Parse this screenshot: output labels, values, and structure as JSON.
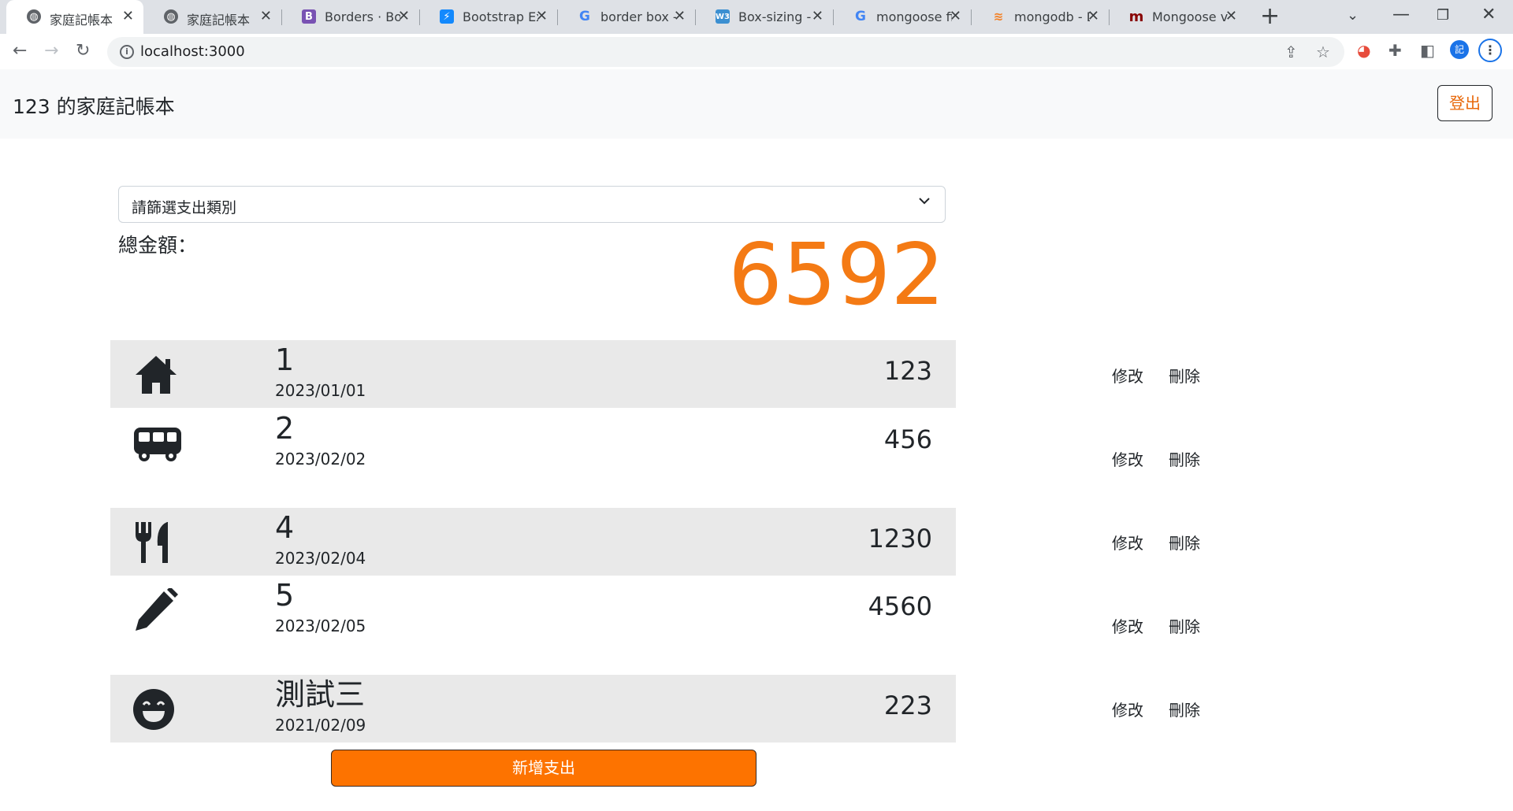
{
  "browser": {
    "tabs": [
      {
        "label": "家庭記帳本",
        "favicon": "globe-icon"
      },
      {
        "label": "家庭記帳本",
        "favicon": "globe-icon"
      },
      {
        "label": "Borders · Boo",
        "favicon": "bootstrap-icon"
      },
      {
        "label": "Bootstrap Exa",
        "favicon": "bolt-icon"
      },
      {
        "label": "border box - (",
        "favicon": "google-icon"
      },
      {
        "label": "Box-sizing - s",
        "favicon": "w3-icon"
      },
      {
        "label": "mongoose fir",
        "favicon": "google-icon"
      },
      {
        "label": "mongodb - D",
        "favicon": "stackoverflow-icon"
      },
      {
        "label": "Mongoose vo",
        "favicon": "mongoose-icon"
      }
    ],
    "url": "localhost:3000",
    "profile_initial": "記"
  },
  "header": {
    "title": "123 的家庭記帳本",
    "logout_label": "登出"
  },
  "filter": {
    "selected": "請篩選支出類別"
  },
  "total": {
    "label": "總金額：",
    "value": "6592"
  },
  "records": [
    {
      "icon": "home-icon",
      "name": "1",
      "date": "2023/01/01",
      "amount": "123"
    },
    {
      "icon": "bus-icon",
      "name": "2",
      "date": "2023/02/02",
      "amount": "456"
    },
    {
      "icon": "utensils-icon",
      "name": "4",
      "date": "2023/02/04",
      "amount": "1230"
    },
    {
      "icon": "pen-icon",
      "name": "5",
      "date": "2023/02/05",
      "amount": "4560"
    },
    {
      "icon": "smile-icon",
      "name": "測試三",
      "date": "2021/02/09",
      "amount": "223"
    }
  ],
  "actions": {
    "edit_label": "修改",
    "delete_label": "刪除"
  },
  "add_button_label": "新增支出",
  "colors": {
    "accent": "#fd7300",
    "total": "#f47a14",
    "row_shade": "#e9e9e9"
  }
}
